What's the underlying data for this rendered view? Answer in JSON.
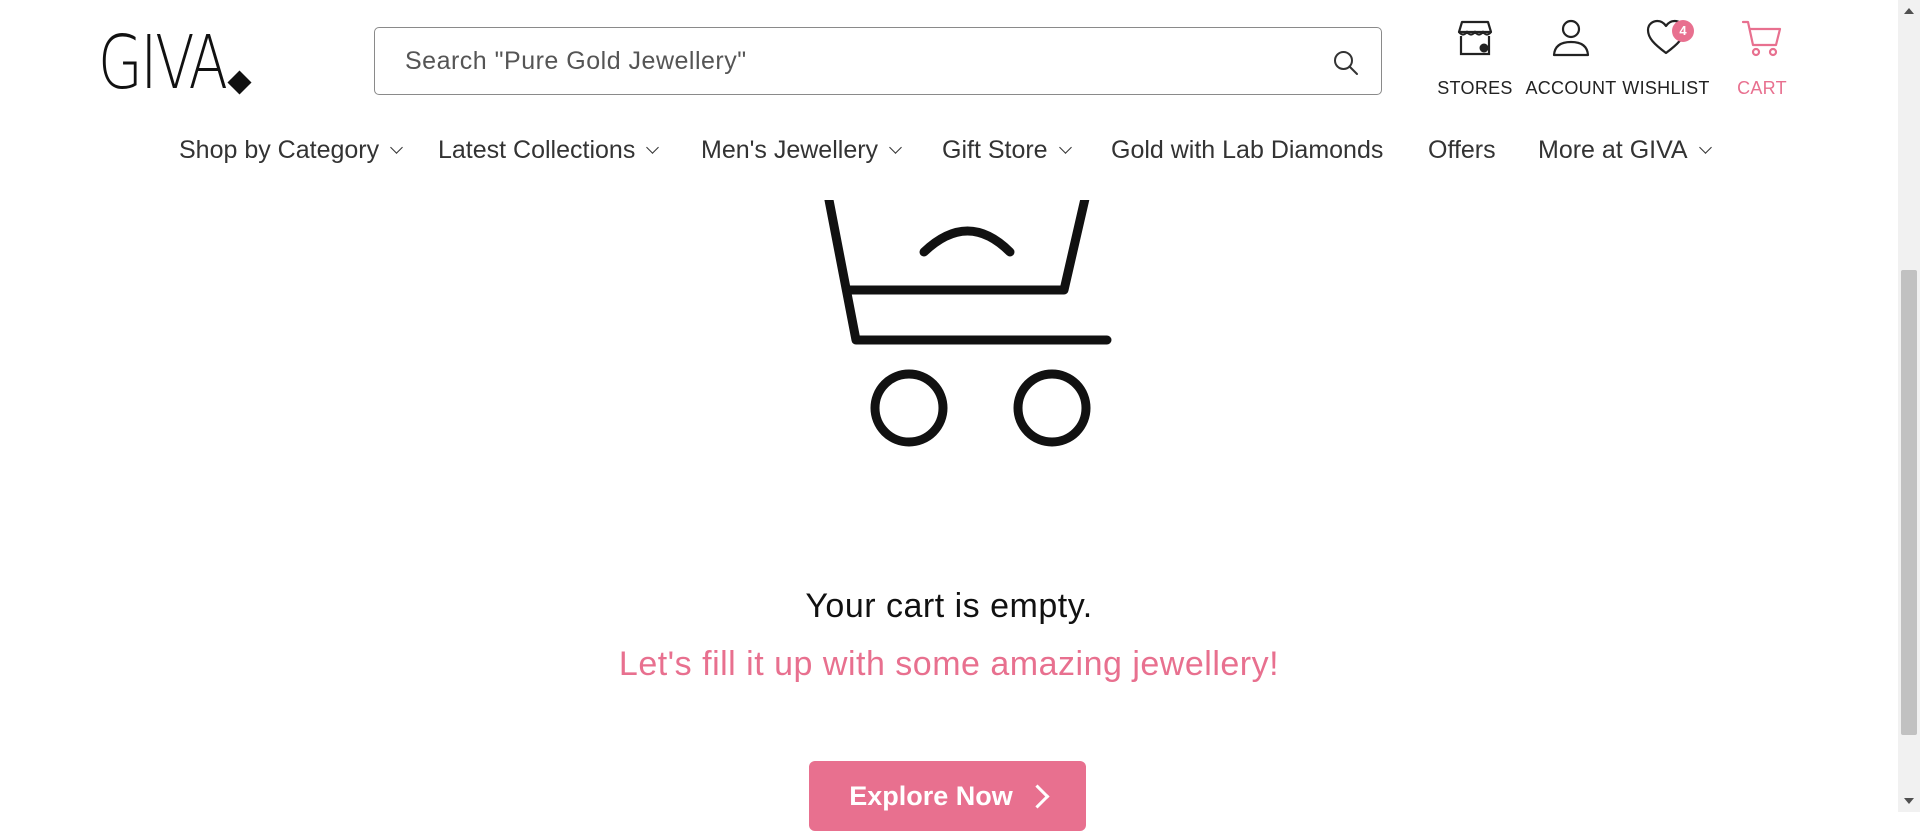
{
  "brand": {
    "logo_text": "GIVA"
  },
  "search": {
    "placeholder": "Search \"Pure Gold Jewellery\""
  },
  "header_icons": [
    {
      "label": "STORES",
      "icon": "store-icon"
    },
    {
      "label": "ACCOUNT",
      "icon": "user-icon"
    },
    {
      "label": "WISHLIST",
      "icon": "heart-icon",
      "badge": "4"
    },
    {
      "label": "CART",
      "icon": "cart-icon"
    }
  ],
  "nav": [
    {
      "label": "Shop by Category",
      "dropdown": true
    },
    {
      "label": "Latest Collections",
      "dropdown": true
    },
    {
      "label": "Men's Jewellery",
      "dropdown": true
    },
    {
      "label": "Gift Store",
      "dropdown": true
    },
    {
      "label": "Gold with Lab Diamonds",
      "dropdown": false
    },
    {
      "label": "Offers",
      "dropdown": false
    },
    {
      "label": "More at GIVA",
      "dropdown": true
    }
  ],
  "empty_cart": {
    "title": "Your cart is empty.",
    "subtitle": "Let's fill it up with some amazing jewellery!",
    "button_label": "Explore Now"
  },
  "colors": {
    "accent": "#e8708f",
    "text": "#222222"
  }
}
